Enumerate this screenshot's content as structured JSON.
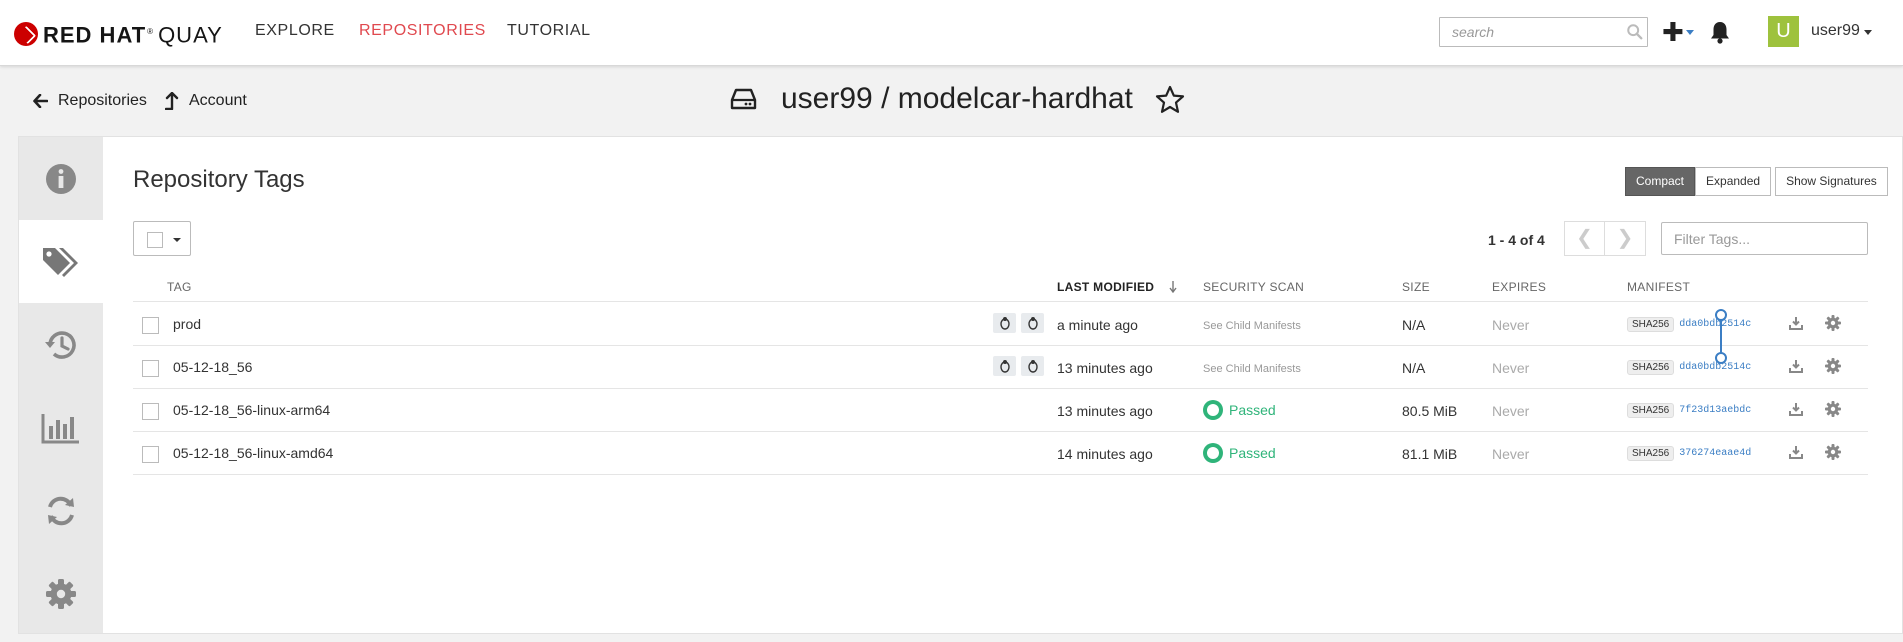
{
  "brand": {
    "primary": "RED HAT",
    "sup": "®",
    "product": "QUAY"
  },
  "nav": {
    "explore": "EXPLORE",
    "repositories": "REPOSITORIES",
    "tutorial": "TUTORIAL"
  },
  "search": {
    "placeholder": "search"
  },
  "user": {
    "initial": "U",
    "name": "user99"
  },
  "breadcrumb": {
    "repositories": "Repositories",
    "account": "Account"
  },
  "repo": {
    "title": "user99 / modelcar-hardhat"
  },
  "tags_page": {
    "title": "Repository Tags",
    "views": {
      "compact": "Compact",
      "expanded": "Expanded",
      "signatures": "Show Signatures"
    },
    "pagination": {
      "text": "1 - 4 of 4",
      "prev": "❮",
      "next": "❯"
    },
    "filter_placeholder": "Filter Tags...",
    "columns": {
      "tag": "TAG",
      "last_modified": "LAST MODIFIED",
      "security_scan": "SECURITY SCAN",
      "size": "SIZE",
      "expires": "EXPIRES",
      "manifest": "MANIFEST"
    },
    "rows": [
      {
        "tag": "prod",
        "last_modified": "a minute ago",
        "security": "See Child Manifests",
        "size": "N/A",
        "expires": "Never",
        "sha_label": "SHA256",
        "digest": "dda0bdb2514c"
      },
      {
        "tag": "05-12-18_56",
        "last_modified": "13 minutes ago",
        "security": "See Child Manifests",
        "size": "N/A",
        "expires": "Never",
        "sha_label": "SHA256",
        "digest": "dda0bdb2514c"
      },
      {
        "tag": "05-12-18_56-linux-arm64",
        "last_modified": "13 minutes ago",
        "security": "Passed",
        "size": "80.5 MiB",
        "expires": "Never",
        "sha_label": "SHA256",
        "digest": "7f23d13aebdc"
      },
      {
        "tag": "05-12-18_56-linux-amd64",
        "last_modified": "14 minutes ago",
        "security": "Passed",
        "size": "81.1 MiB",
        "expires": "Never",
        "sha_label": "SHA256",
        "digest": "376274eaae4d"
      }
    ]
  },
  "colors": {
    "accent_red": "#e0494f",
    "link_blue": "#3b7ec4",
    "passed_green": "#2fb47a",
    "avatar_green": "#9ec23d"
  },
  "icons": {
    "sidebar": [
      "info-icon",
      "tags-icon",
      "history-icon",
      "usage-chart-icon",
      "mirror-sync-icon",
      "settings-icon"
    ],
    "row_actions": [
      "download-icon",
      "gear-icon"
    ],
    "arch": "linux-tux-icon"
  }
}
